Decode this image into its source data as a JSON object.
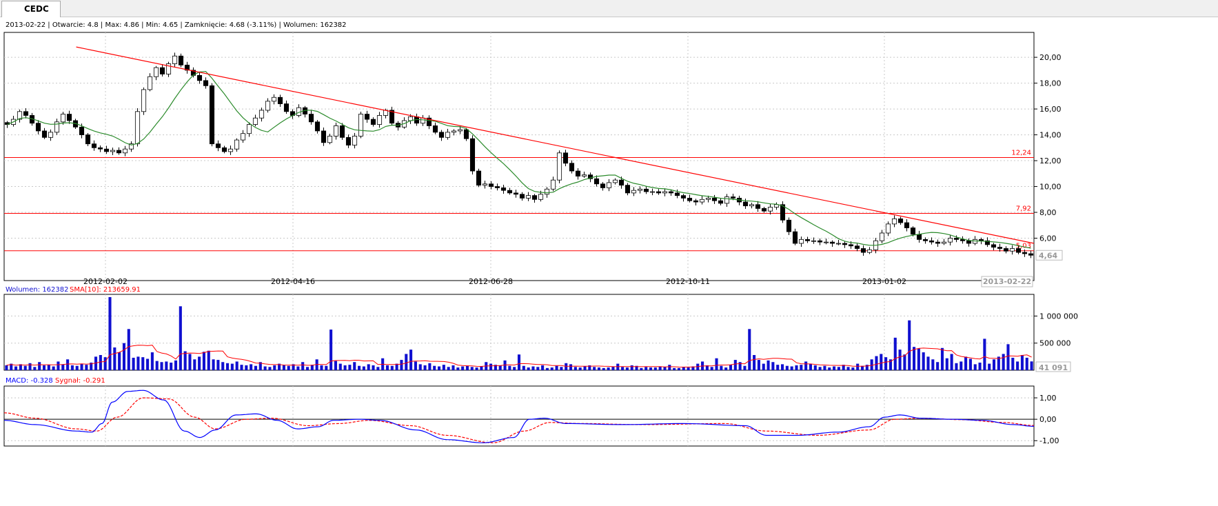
{
  "tab": {
    "title": "CEDC"
  },
  "info_line": "2013-02-22 | Otwarcie: 4.8 | Max: 4.86 | Min: 4.65 | Zamknięcie: 4.68 (-3.11%)  | Wolumen: 162382",
  "colors": {
    "up": "#ffffff",
    "down": "#000000",
    "sma": "#2a8a2a",
    "line": "#ff0000",
    "volume": "#1010d0",
    "macd": "#0000ff",
    "signal": "#ff0000"
  },
  "chart_data": [
    {
      "type": "candlestick",
      "series_name": "CEDC",
      "y_range": [
        4.0,
        21.5
      ],
      "y_ticks": [
        "20,00",
        "18,00",
        "16,00",
        "14,00",
        "12,00",
        "10,00",
        "8,00",
        "6,00"
      ],
      "x_ticks": [
        "2012-02-02",
        "2012-04-16",
        "2012-06-28",
        "2012-10-11",
        "2013-01-02"
      ],
      "last_price_label": "4,64",
      "last_date_label": "2013-02-22",
      "horizontal_lines": [
        {
          "value": 12.24,
          "label": "12,24"
        },
        {
          "value": 7.92,
          "label": "7,92"
        },
        {
          "value": 5.03,
          "label": "5,03"
        }
      ],
      "trend_line": {
        "from": [
          0.07,
          20.8
        ],
        "to": [
          1.0,
          5.6
        ]
      },
      "closes": [
        14.8,
        15.2,
        15.8,
        15.5,
        14.9,
        14.3,
        13.8,
        14.2,
        15.0,
        15.6,
        15.1,
        14.6,
        14.0,
        13.3,
        13.0,
        12.9,
        12.7,
        12.8,
        12.6,
        12.9,
        13.3,
        15.8,
        17.5,
        18.5,
        19.2,
        18.7,
        19.5,
        20.1,
        19.4,
        19.0,
        18.6,
        18.2,
        17.8,
        13.3,
        13.0,
        12.7,
        12.9,
        13.6,
        14.1,
        14.8,
        15.3,
        15.9,
        16.6,
        16.9,
        16.4,
        15.8,
        15.5,
        16.1,
        15.6,
        15.0,
        14.3,
        13.4,
        13.9,
        14.7,
        13.8,
        13.2,
        13.9,
        15.6,
        15.2,
        14.8,
        15.5,
        15.9,
        14.9,
        14.6,
        15.1,
        15.4,
        14.9,
        15.3,
        14.7,
        14.2,
        13.8,
        14.2,
        14.3,
        14.4,
        13.7,
        11.2,
        10.1,
        10.2,
        10.0,
        9.9,
        9.7,
        9.5,
        9.4,
        9.1,
        9.3,
        9.0,
        9.4,
        9.8,
        10.5,
        12.6,
        11.8,
        11.2,
        10.8,
        10.9,
        10.6,
        10.2,
        9.9,
        10.3,
        10.5,
        10.1,
        9.5,
        9.7,
        9.8,
        9.6,
        9.6,
        9.5,
        9.6,
        9.5,
        9.3,
        9.1,
        8.9,
        8.8,
        9.0,
        9.1,
        8.9,
        8.7,
        9.2,
        9.1,
        8.8,
        8.5,
        8.6,
        8.3,
        8.1,
        8.4,
        8.6,
        7.4,
        6.5,
        5.6,
        5.9,
        5.8,
        5.8,
        5.7,
        5.7,
        5.6,
        5.6,
        5.5,
        5.4,
        5.2,
        4.9,
        5.1,
        5.8,
        6.4,
        7.1,
        7.5,
        7.2,
        6.8,
        6.3,
        5.9,
        5.8,
        5.7,
        5.6,
        5.7,
        6.0,
        5.9,
        5.8,
        5.6,
        5.9,
        5.8,
        5.5,
        5.3,
        5.2,
        5.0,
        5.2,
        4.9,
        4.8,
        4.68
      ],
      "sma_label": "SMA",
      "sma_period": 10
    },
    {
      "type": "bar",
      "title": "Wolumen: 162382",
      "overlay_label": "SMA[10]: 213659.91",
      "y_range": [
        0,
        1400000
      ],
      "y_ticks": [
        "1 000 000",
        "500 000"
      ],
      "last_value_label": "41 091",
      "volumes": [
        90000,
        120000,
        70000,
        110000,
        80000,
        130000,
        60000,
        150000,
        90000,
        100000,
        70000,
        160000,
        110000,
        200000,
        90000,
        80000,
        120000,
        100000,
        140000,
        250000,
        280000,
        240000,
        1350000,
        420000,
        330000,
        500000,
        760000,
        230000,
        250000,
        240000,
        210000,
        330000,
        170000,
        150000,
        160000,
        140000,
        180000,
        1180000,
        350000,
        300000,
        200000,
        250000,
        340000,
        360000,
        200000,
        190000,
        150000,
        130000,
        120000,
        160000,
        100000,
        90000,
        110000,
        80000,
        150000,
        70000,
        60000,
        90000,
        120000,
        90000,
        80000,
        110000,
        70000,
        150000,
        60000,
        100000,
        200000,
        90000,
        80000,
        750000,
        170000,
        120000,
        90000,
        100000,
        150000,
        80000,
        70000,
        110000,
        90000,
        60000,
        220000,
        90000,
        80000,
        120000,
        190000,
        300000,
        380000,
        160000,
        110000,
        90000,
        130000,
        80000,
        70000,
        100000,
        60000,
        90000,
        50000,
        70000,
        80000,
        60000,
        50000,
        70000,
        150000,
        120000,
        100000,
        90000,
        180000,
        80000,
        60000,
        290000,
        80000,
        50000,
        70000,
        60000,
        90000,
        40000,
        50000,
        80000,
        60000,
        130000,
        110000,
        60000,
        50000,
        70000,
        90000,
        60000,
        50000,
        40000,
        50000,
        70000,
        120000,
        60000,
        50000,
        90000,
        80000,
        40000,
        60000,
        50000,
        50000,
        70000,
        60000,
        100000,
        40000,
        40000,
        60000,
        50000,
        70000,
        120000,
        160000,
        90000,
        60000,
        220000,
        80000,
        50000,
        100000,
        190000,
        150000,
        80000,
        760000,
        280000,
        190000,
        120000,
        180000,
        150000,
        100000,
        110000,
        80000,
        70000,
        90000,
        100000,
        160000,
        120000,
        90000,
        60000,
        80000,
        50000,
        70000,
        60000,
        100000,
        60000,
        50000,
        120000,
        80000,
        100000,
        200000,
        260000,
        300000,
        240000,
        200000,
        600000,
        380000,
        290000,
        920000,
        430000,
        400000,
        330000,
        250000,
        200000,
        150000,
        410000,
        220000,
        300000,
        130000,
        160000,
        250000,
        210000,
        110000,
        140000,
        580000,
        120000,
        200000,
        250000,
        300000,
        480000,
        230000,
        160000,
        280000,
        230000,
        162382
      ]
    },
    {
      "type": "line",
      "title": "MACD: -0.328",
      "signal_label": "Sygnał: -0.291",
      "y_range": [
        -1.25,
        1.55
      ],
      "y_ticks": [
        "1,00",
        "0,00",
        "-1,00"
      ],
      "macd_knots": [
        [
          0,
          -0.05
        ],
        [
          0.03,
          -0.25
        ],
        [
          0.07,
          -0.55
        ],
        [
          0.085,
          -0.6
        ],
        [
          0.095,
          -0.2
        ],
        [
          0.105,
          0.8
        ],
        [
          0.12,
          1.3
        ],
        [
          0.135,
          1.35
        ],
        [
          0.155,
          0.9
        ],
        [
          0.175,
          -0.55
        ],
        [
          0.19,
          -0.85
        ],
        [
          0.205,
          -0.5
        ],
        [
          0.225,
          0.2
        ],
        [
          0.245,
          0.25
        ],
        [
          0.265,
          -0.05
        ],
        [
          0.285,
          -0.45
        ],
        [
          0.305,
          -0.35
        ],
        [
          0.32,
          -0.05
        ],
        [
          0.345,
          0.0
        ],
        [
          0.365,
          -0.05
        ],
        [
          0.4,
          -0.5
        ],
        [
          0.43,
          -0.95
        ],
        [
          0.465,
          -1.1
        ],
        [
          0.495,
          -0.85
        ],
        [
          0.51,
          0.0
        ],
        [
          0.525,
          0.05
        ],
        [
          0.545,
          -0.2
        ],
        [
          0.6,
          -0.25
        ],
        [
          0.66,
          -0.2
        ],
        [
          0.72,
          -0.3
        ],
        [
          0.74,
          -0.75
        ],
        [
          0.77,
          -0.75
        ],
        [
          0.81,
          -0.6
        ],
        [
          0.84,
          -0.35
        ],
        [
          0.855,
          0.1
        ],
        [
          0.87,
          0.2
        ],
        [
          0.89,
          0.05
        ],
        [
          0.92,
          0.0
        ],
        [
          0.95,
          -0.05
        ],
        [
          0.98,
          -0.25
        ],
        [
          1.0,
          -0.33
        ]
      ],
      "signal_knots": [
        [
          0,
          0.3
        ],
        [
          0.03,
          0.05
        ],
        [
          0.07,
          -0.45
        ],
        [
          0.09,
          -0.55
        ],
        [
          0.11,
          0.1
        ],
        [
          0.135,
          1.0
        ],
        [
          0.16,
          0.95
        ],
        [
          0.185,
          0.1
        ],
        [
          0.205,
          -0.45
        ],
        [
          0.235,
          0.0
        ],
        [
          0.26,
          0.05
        ],
        [
          0.295,
          -0.3
        ],
        [
          0.325,
          -0.2
        ],
        [
          0.355,
          -0.05
        ],
        [
          0.395,
          -0.3
        ],
        [
          0.43,
          -0.75
        ],
        [
          0.475,
          -1.1
        ],
        [
          0.505,
          -0.55
        ],
        [
          0.53,
          -0.15
        ],
        [
          0.56,
          -0.2
        ],
        [
          0.62,
          -0.25
        ],
        [
          0.7,
          -0.2
        ],
        [
          0.74,
          -0.55
        ],
        [
          0.79,
          -0.75
        ],
        [
          0.84,
          -0.5
        ],
        [
          0.865,
          0.0
        ],
        [
          0.89,
          0.05
        ],
        [
          0.93,
          -0.02
        ],
        [
          0.97,
          -0.15
        ],
        [
          1.0,
          -0.29
        ]
      ]
    }
  ]
}
